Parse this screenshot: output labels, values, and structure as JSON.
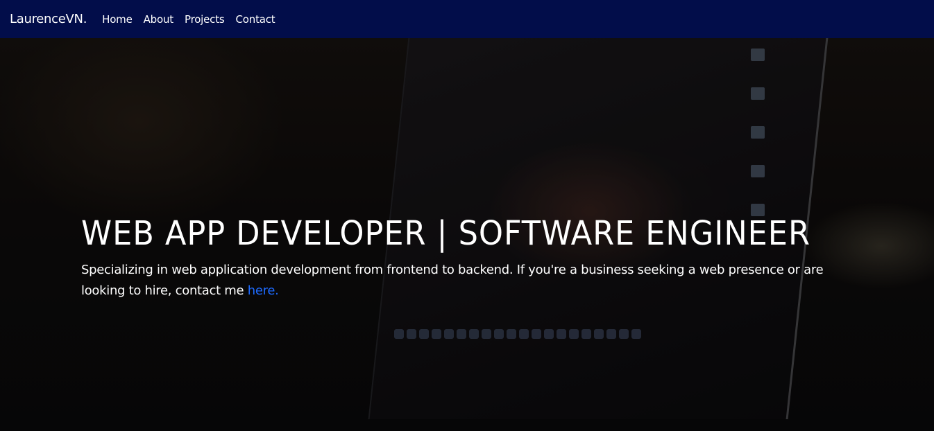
{
  "navbar": {
    "brand": "LaurenceVN.",
    "links": [
      {
        "label": "Home"
      },
      {
        "label": "About"
      },
      {
        "label": "Projects"
      },
      {
        "label": "Contact"
      }
    ]
  },
  "hero": {
    "title": "WEB APP DEVELOPER | SOFTWARE ENGINEER",
    "text": "Specializing in web application development from frontend to backend. If you're a business seeking a web presence or are looking to hire, contact me ",
    "link_label": "here."
  },
  "colors": {
    "navbar_bg": "#020d4a",
    "link_accent": "#1e6bff",
    "text": "#ffffff"
  }
}
